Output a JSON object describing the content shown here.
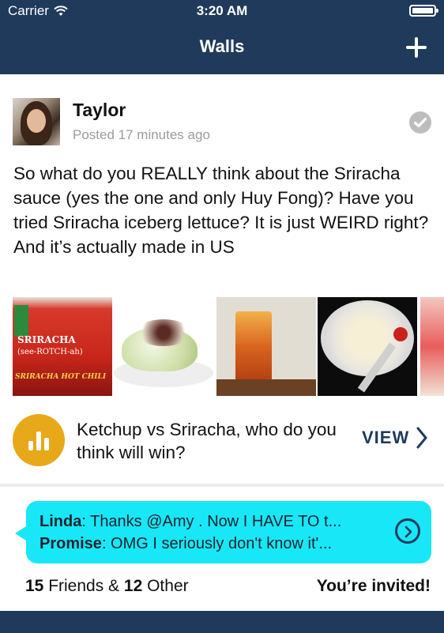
{
  "status_bar": {
    "carrier": "Carrier",
    "time": "3:20 AM"
  },
  "nav": {
    "title": "Walls"
  },
  "post": {
    "author": "Taylor",
    "posted": "Posted 17 minutes ago",
    "text": "So what do you REALLY think about the Sriracha sauce (yes the one and only Huy Fong)? Have you tried Sriracha iceberg lettuce? It is just WEIRD right? And it’s actually made in US",
    "images": [
      {
        "label_line1": "SRIRACHA",
        "label_line2": "(see-ROTCH-ah)",
        "label_line3": "SRIRACHA HOT CHILI"
      }
    ]
  },
  "poll": {
    "question": "Ketchup vs Sriracha, who do you think will win?",
    "view_label": "VIEW"
  },
  "chat": {
    "messages": [
      {
        "sender": "Linda",
        "text": ": Thanks @Amy . Now I HAVE TO t..."
      },
      {
        "sender": "Promise",
        "text": ": OMG I seriously don't know it'..."
      }
    ]
  },
  "footer": {
    "friends_count": "15",
    "friends_label": " Friends & ",
    "other_count": "12",
    "other_label": " Other",
    "invited": "You’re invited!"
  },
  "colors": {
    "nav_bg": "#1f3a5b",
    "bubble": "#18e7f7",
    "poll_icon": "#e7a819"
  }
}
